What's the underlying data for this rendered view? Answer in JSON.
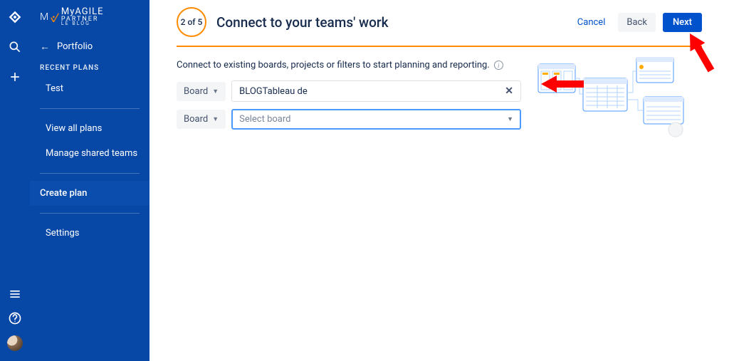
{
  "brand": {
    "line1": "MyAGILE",
    "line2": "PARTNER",
    "sub": "LE BLOG"
  },
  "rail": {
    "logo": "jira-logo",
    "search": "search",
    "add": "add",
    "menu": "menu",
    "help": "help"
  },
  "sidebar": {
    "portfolio_label": "Portfolio",
    "section_title": "RECENT PLANS",
    "items": [
      "Test"
    ],
    "view_all": "View all plans",
    "manage_shared": "Manage shared teams",
    "create_plan": "Create plan",
    "settings": "Settings"
  },
  "wizard": {
    "step": "2 of 5",
    "title": "Connect to your teams' work",
    "cancel": "Cancel",
    "back": "Back",
    "next": "Next",
    "subtext": "Connect to existing boards, projects or filters to start planning and reporting."
  },
  "form": {
    "rows": [
      {
        "source": "Board",
        "value": "BLOGTableau de",
        "placeholder": "",
        "has_clear": true,
        "has_caret": false,
        "highlight": false
      },
      {
        "source": "Board",
        "value": "",
        "placeholder": "Select board",
        "has_clear": false,
        "has_caret": true,
        "highlight": true
      }
    ]
  }
}
